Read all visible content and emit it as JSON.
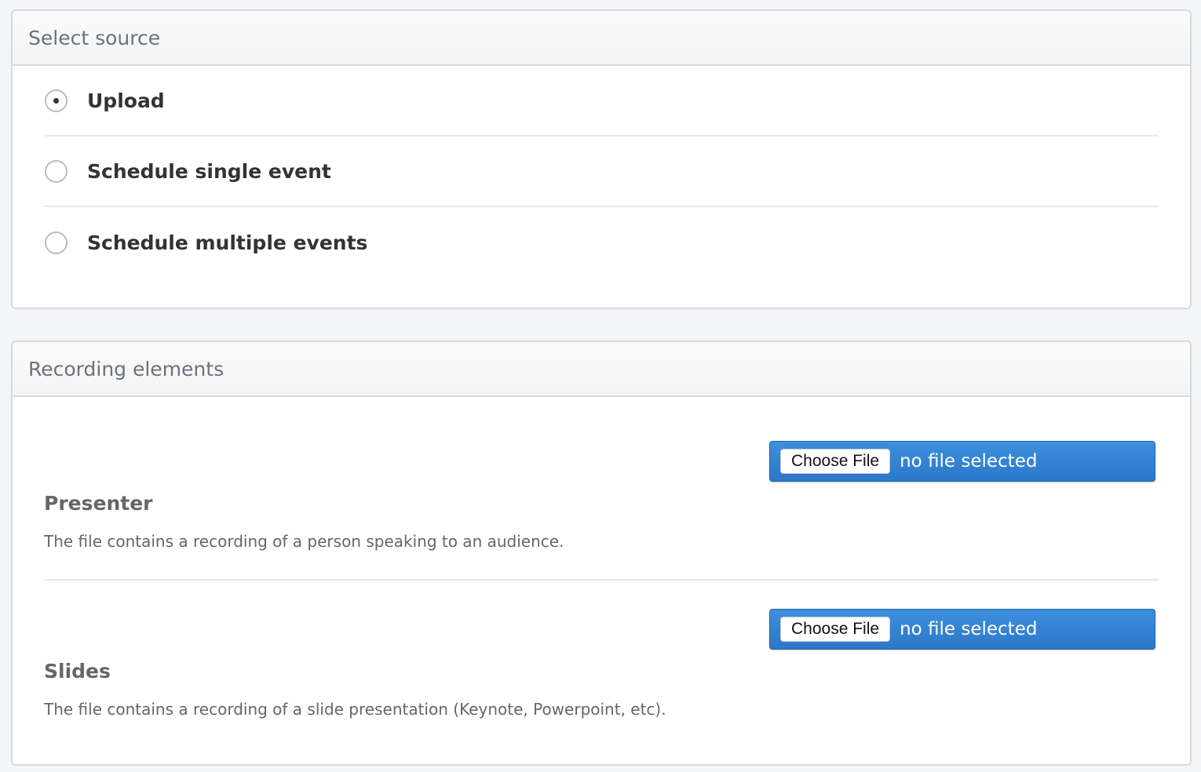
{
  "source_panel": {
    "title": "Select source",
    "options": [
      {
        "label": "Upload",
        "checked": true
      },
      {
        "label": "Schedule single event",
        "checked": false
      },
      {
        "label": "Schedule multiple events",
        "checked": false
      }
    ]
  },
  "elements_panel": {
    "title": "Recording elements",
    "items": [
      {
        "button_label": "Choose File",
        "file_status": "no file selected",
        "title": "Presenter",
        "description": "The file contains a recording of a person speaking to an audience."
      },
      {
        "button_label": "Choose File",
        "file_status": "no file selected",
        "title": "Slides",
        "description": "The file contains a recording of a slide presentation (Keynote, Powerpoint, etc)."
      }
    ]
  },
  "colors": {
    "accent": "#2c78c8",
    "text": "#333333",
    "muted": "#6a737b"
  }
}
